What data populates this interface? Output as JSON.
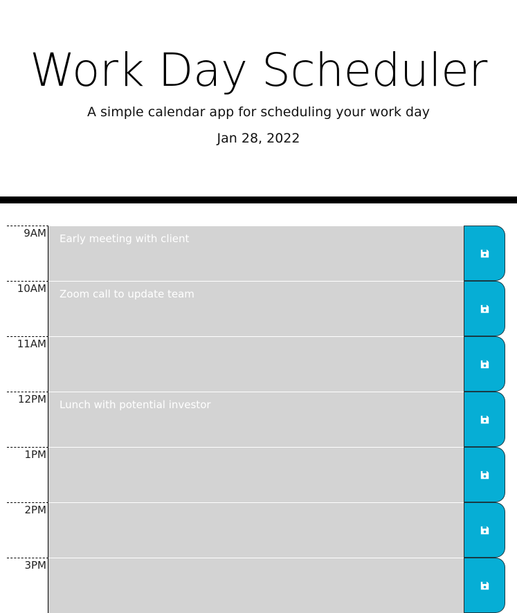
{
  "header": {
    "title": "Work Day Scheduler",
    "subtitle": "A simple calendar app for scheduling your work day",
    "current_day": "Jan 28, 2022"
  },
  "colors": {
    "past": "#d3d3d3",
    "save_button": "#06aed5",
    "divider": "#000000"
  },
  "time_blocks": [
    {
      "hour": "9AM",
      "text": "Early meeting with client",
      "save_icon": "floppy-disk-icon"
    },
    {
      "hour": "10AM",
      "text": "Zoom call to update team",
      "save_icon": "floppy-disk-icon"
    },
    {
      "hour": "11AM",
      "text": "",
      "save_icon": "floppy-disk-icon"
    },
    {
      "hour": "12PM",
      "text": "Lunch with potential investor",
      "save_icon": "floppy-disk-icon"
    },
    {
      "hour": "1PM",
      "text": "",
      "save_icon": "floppy-disk-icon"
    },
    {
      "hour": "2PM",
      "text": "",
      "save_icon": "floppy-disk-icon"
    },
    {
      "hour": "3PM",
      "text": "",
      "save_icon": "floppy-disk-icon"
    }
  ]
}
